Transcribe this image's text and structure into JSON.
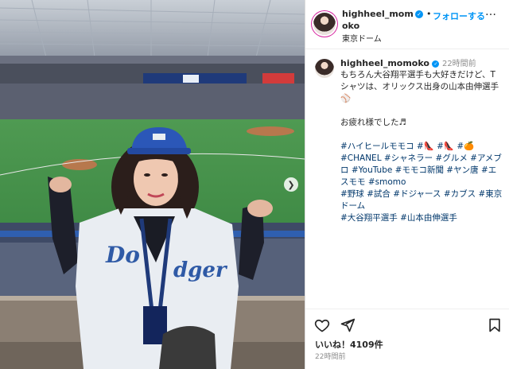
{
  "post": {
    "username": "highheel_momoko",
    "follow_label": "フォローする",
    "follow_separator": "•",
    "location": "東京ドーム",
    "more_label": "…"
  },
  "caption": {
    "username": "highheel_momoko",
    "time": "22時間前",
    "line1": "もちろん大谷翔平選手も大好きだけど、Tシャツは、オリックス出身の山本由伸選手⚾",
    "line2": "お疲れ様でした♬",
    "tags1": "#ハイヒールモモコ #👠 #👠 #🍊",
    "tags2": "#CHANEL #シャネラー #グルメ #アメブロ #YouTube #モモコ新聞 #ヤン唐 #エスモモ #smomo",
    "tags3": "#野球 #試合 #ドジャース #カブス #東京ドーム",
    "tags4": "#大谷翔平選手 #山本由伸選手"
  },
  "engagement": {
    "likes": "いいね！4109件",
    "time_ago": "22時間前"
  },
  "icons": {
    "heart": "heart-icon",
    "share": "share-icon",
    "bookmark": "bookmark-icon",
    "verified": "verified-badge-icon",
    "next": "chevron-right-icon"
  },
  "colors": {
    "accent": "#0095f6",
    "hashtag": "#00376b",
    "muted": "#8e8e8e"
  }
}
